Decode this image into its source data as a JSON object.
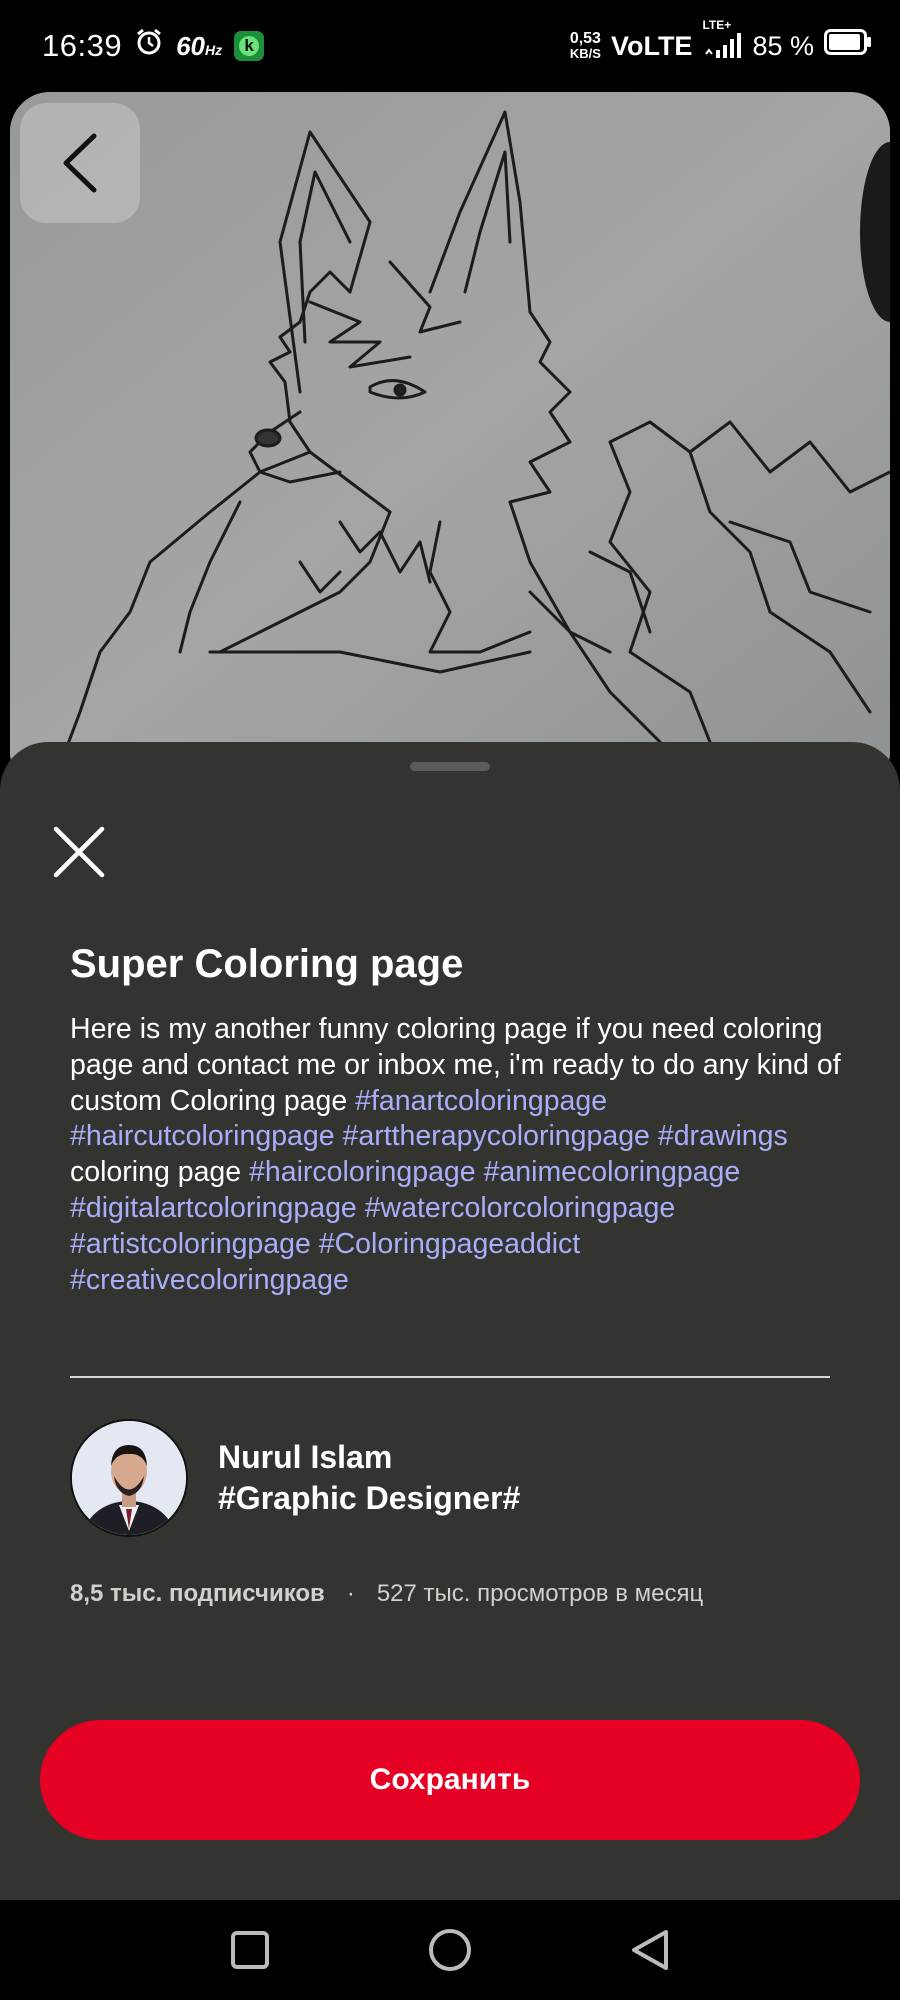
{
  "status_bar": {
    "time": "16:39",
    "refresh_rate": "60",
    "refresh_unit": "Hz",
    "net_speed_value": "0,53",
    "net_speed_unit": "KB/S",
    "network": "VoLTE",
    "network_type": "LTE+",
    "battery": "85 %"
  },
  "pin": {
    "image_icon": "fox-sketch-image",
    "title": "Super Coloring page",
    "description_parts": [
      {
        "text": "Here is my another funny coloring page if you need coloring page and contact me or inbox me, i'm ready to do any kind of custom Coloring page ",
        "hashtag": false
      },
      {
        "text": "#fanartcoloringpage",
        "hashtag": true
      },
      {
        "text": " ",
        "hashtag": false
      },
      {
        "text": "#haircutcoloringpage",
        "hashtag": true
      },
      {
        "text": " ",
        "hashtag": false
      },
      {
        "text": "#arttherapycoloringpage",
        "hashtag": true
      },
      {
        "text": " ",
        "hashtag": false
      },
      {
        "text": "#drawings",
        "hashtag": true
      },
      {
        "text": " coloring page ",
        "hashtag": false
      },
      {
        "text": "#haircoloringpage",
        "hashtag": true
      },
      {
        "text": " ",
        "hashtag": false
      },
      {
        "text": "#animecoloringpage",
        "hashtag": true
      },
      {
        "text": " ",
        "hashtag": false
      },
      {
        "text": "#digitalartcoloringpage",
        "hashtag": true
      },
      {
        "text": " ",
        "hashtag": false
      },
      {
        "text": "#watercolorcoloringpage",
        "hashtag": true
      },
      {
        "text": " ",
        "hashtag": false
      },
      {
        "text": "#artistcoloringpage",
        "hashtag": true
      },
      {
        "text": " ",
        "hashtag": false
      },
      {
        "text": "#Coloringpageaddict",
        "hashtag": true
      },
      {
        "text": " ",
        "hashtag": false
      },
      {
        "text": "#creativecoloringpage",
        "hashtag": true
      }
    ]
  },
  "creator": {
    "name_line1": "Nurul Islam",
    "name_line2": "#Graphic Designer#",
    "followers": "8,5 тыс. подписчиков",
    "separator": "·",
    "views": "527 тыс. просмотров в месяц"
  },
  "actions": {
    "save_label": "Сохранить"
  },
  "colors": {
    "sheet_bg": "#33332f",
    "hashtag": "#a9aefb",
    "save_button": "#e60023"
  }
}
